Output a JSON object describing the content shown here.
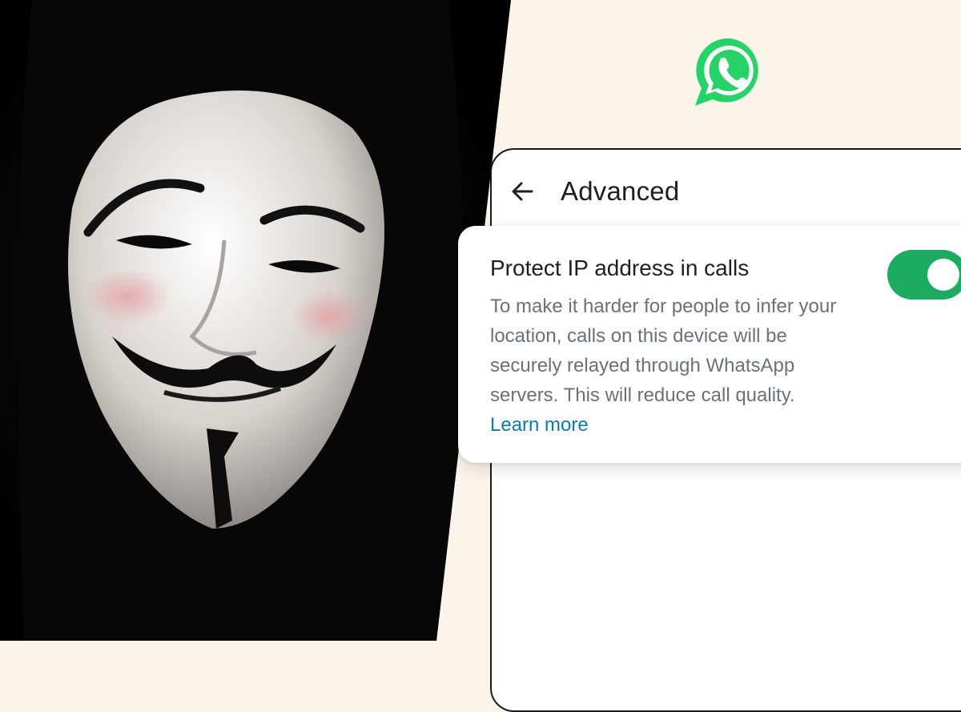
{
  "app_bar": {
    "title": "Advanced"
  },
  "setting": {
    "title": "Protect IP address in calls",
    "description": "To make it harder for people to infer your location, calls on this device will be securely relayed through WhatsApp servers. This will reduce call quality.",
    "link_text": "Learn more",
    "enabled": true
  },
  "icons": {
    "back": "arrow-left-icon",
    "logo": "whatsapp-logo",
    "toggle": "toggle-switch-on"
  },
  "colors": {
    "whatsapp_green": "#25d366",
    "toggle_on": "#1daa61",
    "link": "#0a7cad",
    "background": "#faf4ea"
  }
}
